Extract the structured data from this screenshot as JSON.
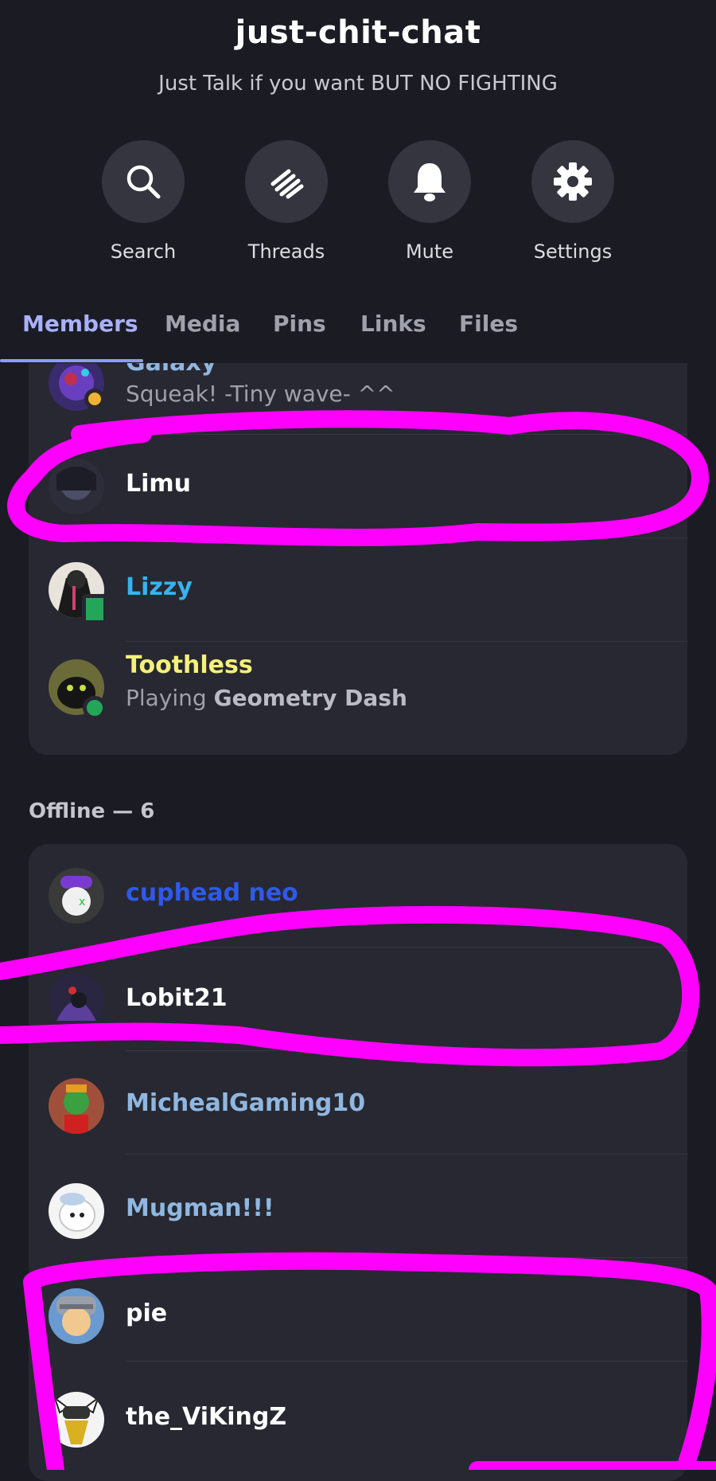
{
  "header": {
    "channel_title": "just-chit-chat",
    "channel_topic": "Just Talk if you want BUT NO FIGHTING"
  },
  "actions": [
    {
      "label": "Search",
      "icon": "search-icon"
    },
    {
      "label": "Threads",
      "icon": "threads-icon"
    },
    {
      "label": "Mute",
      "icon": "bell-icon"
    },
    {
      "label": "Settings",
      "icon": "gear-icon"
    }
  ],
  "tabs": [
    {
      "label": "Members",
      "active": true
    },
    {
      "label": "Media",
      "active": false
    },
    {
      "label": "Pins",
      "active": false
    },
    {
      "label": "Links",
      "active": false
    },
    {
      "label": "Files",
      "active": false
    }
  ],
  "online_members": [
    {
      "name": "Galaxy",
      "status": "Squeak! -Tiny wave- ^^",
      "color": "#8fb7e0",
      "presence": "idle"
    },
    {
      "name": "Limu",
      "status": "",
      "color": "#ffffff",
      "presence": "none"
    },
    {
      "name": "Lizzy",
      "status": "",
      "color": "#36b3f0",
      "presence": "mobile"
    },
    {
      "name": "Toothless",
      "status_prefix": "Playing ",
      "status_game": "Geometry Dash",
      "color": "#f4f17a",
      "presence": "online"
    }
  ],
  "offline_section": {
    "label": "Offline — 6"
  },
  "offline_members": [
    {
      "name": "cuphead neo",
      "color": "#2f59e8"
    },
    {
      "name": "Lobit21",
      "color": "#ffffff"
    },
    {
      "name": "MichealGaming10",
      "color": "#8fb7e0"
    },
    {
      "name": "Mugman!!!",
      "color": "#8fb7e0"
    },
    {
      "name": "pie",
      "color": "#ffffff"
    },
    {
      "name": "the_ViKingZ",
      "color": "#ffffff"
    }
  ],
  "colors": {
    "background": "#1b1c23",
    "panel": "#272831",
    "accent": "#a9b1ff",
    "annotation": "#ff00ff",
    "presence_online": "#23a55a",
    "presence_idle": "#f0b232"
  }
}
